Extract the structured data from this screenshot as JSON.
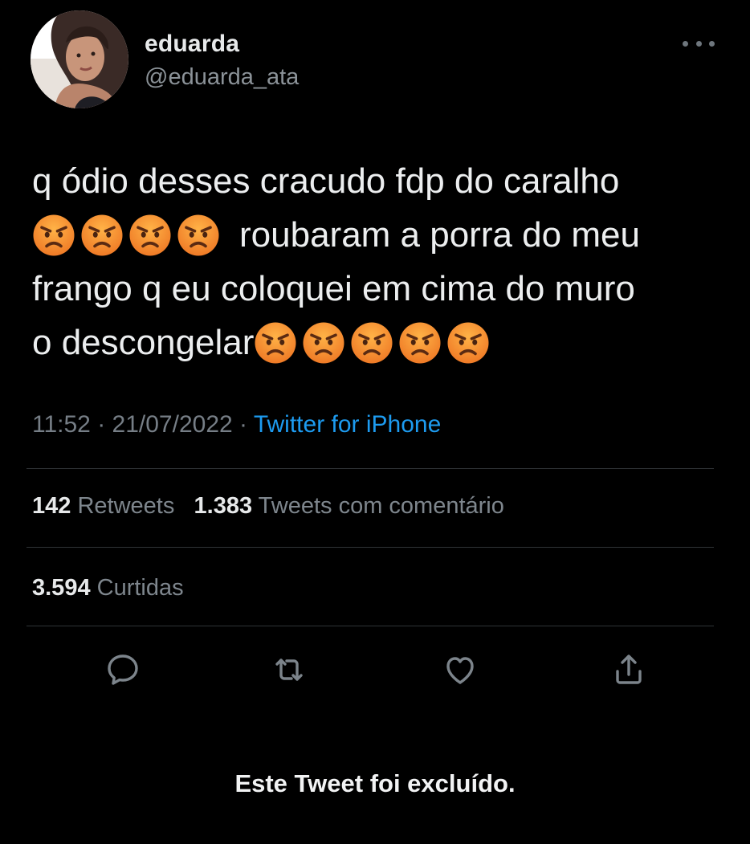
{
  "user": {
    "display_name": "eduarda",
    "handle": "@eduarda_ata",
    "avatar_icon": "profile-photo"
  },
  "tweet": {
    "lines": [
      {
        "segments": [
          {
            "t": "text",
            "v": "q ódio desses cracudo fdp do caralho"
          }
        ]
      },
      {
        "segments": [
          {
            "t": "emoji",
            "count": 4,
            "name": "angry-face"
          },
          {
            "t": "text",
            "v": "roubaram a porra do meu"
          }
        ]
      },
      {
        "segments": [
          {
            "t": "text",
            "v": "frango q eu coloquei em cima do muro"
          }
        ]
      },
      {
        "segments": [
          {
            "t": "text",
            "v": "o descongelar"
          },
          {
            "t": "emoji",
            "count": 5,
            "name": "angry-face"
          }
        ]
      }
    ],
    "time": "11:52",
    "date": "21/07/2022",
    "separator": "·",
    "source": "Twitter for iPhone"
  },
  "stats": {
    "retweets_count": "142",
    "retweets_label": "Retweets",
    "quotes_count": "1.383",
    "quotes_label": "Tweets com comentário",
    "likes_count": "3.594",
    "likes_label": "Curtidas"
  },
  "actions": [
    "reply-icon",
    "retweet-icon",
    "like-icon",
    "share-icon"
  ],
  "footer": {
    "deleted_notice": "Este Tweet foi excluído."
  },
  "colors": {
    "background": "#000000",
    "link": "#1d9bf0",
    "muted": "#767e86",
    "emoji_face": "#ef7a26"
  }
}
